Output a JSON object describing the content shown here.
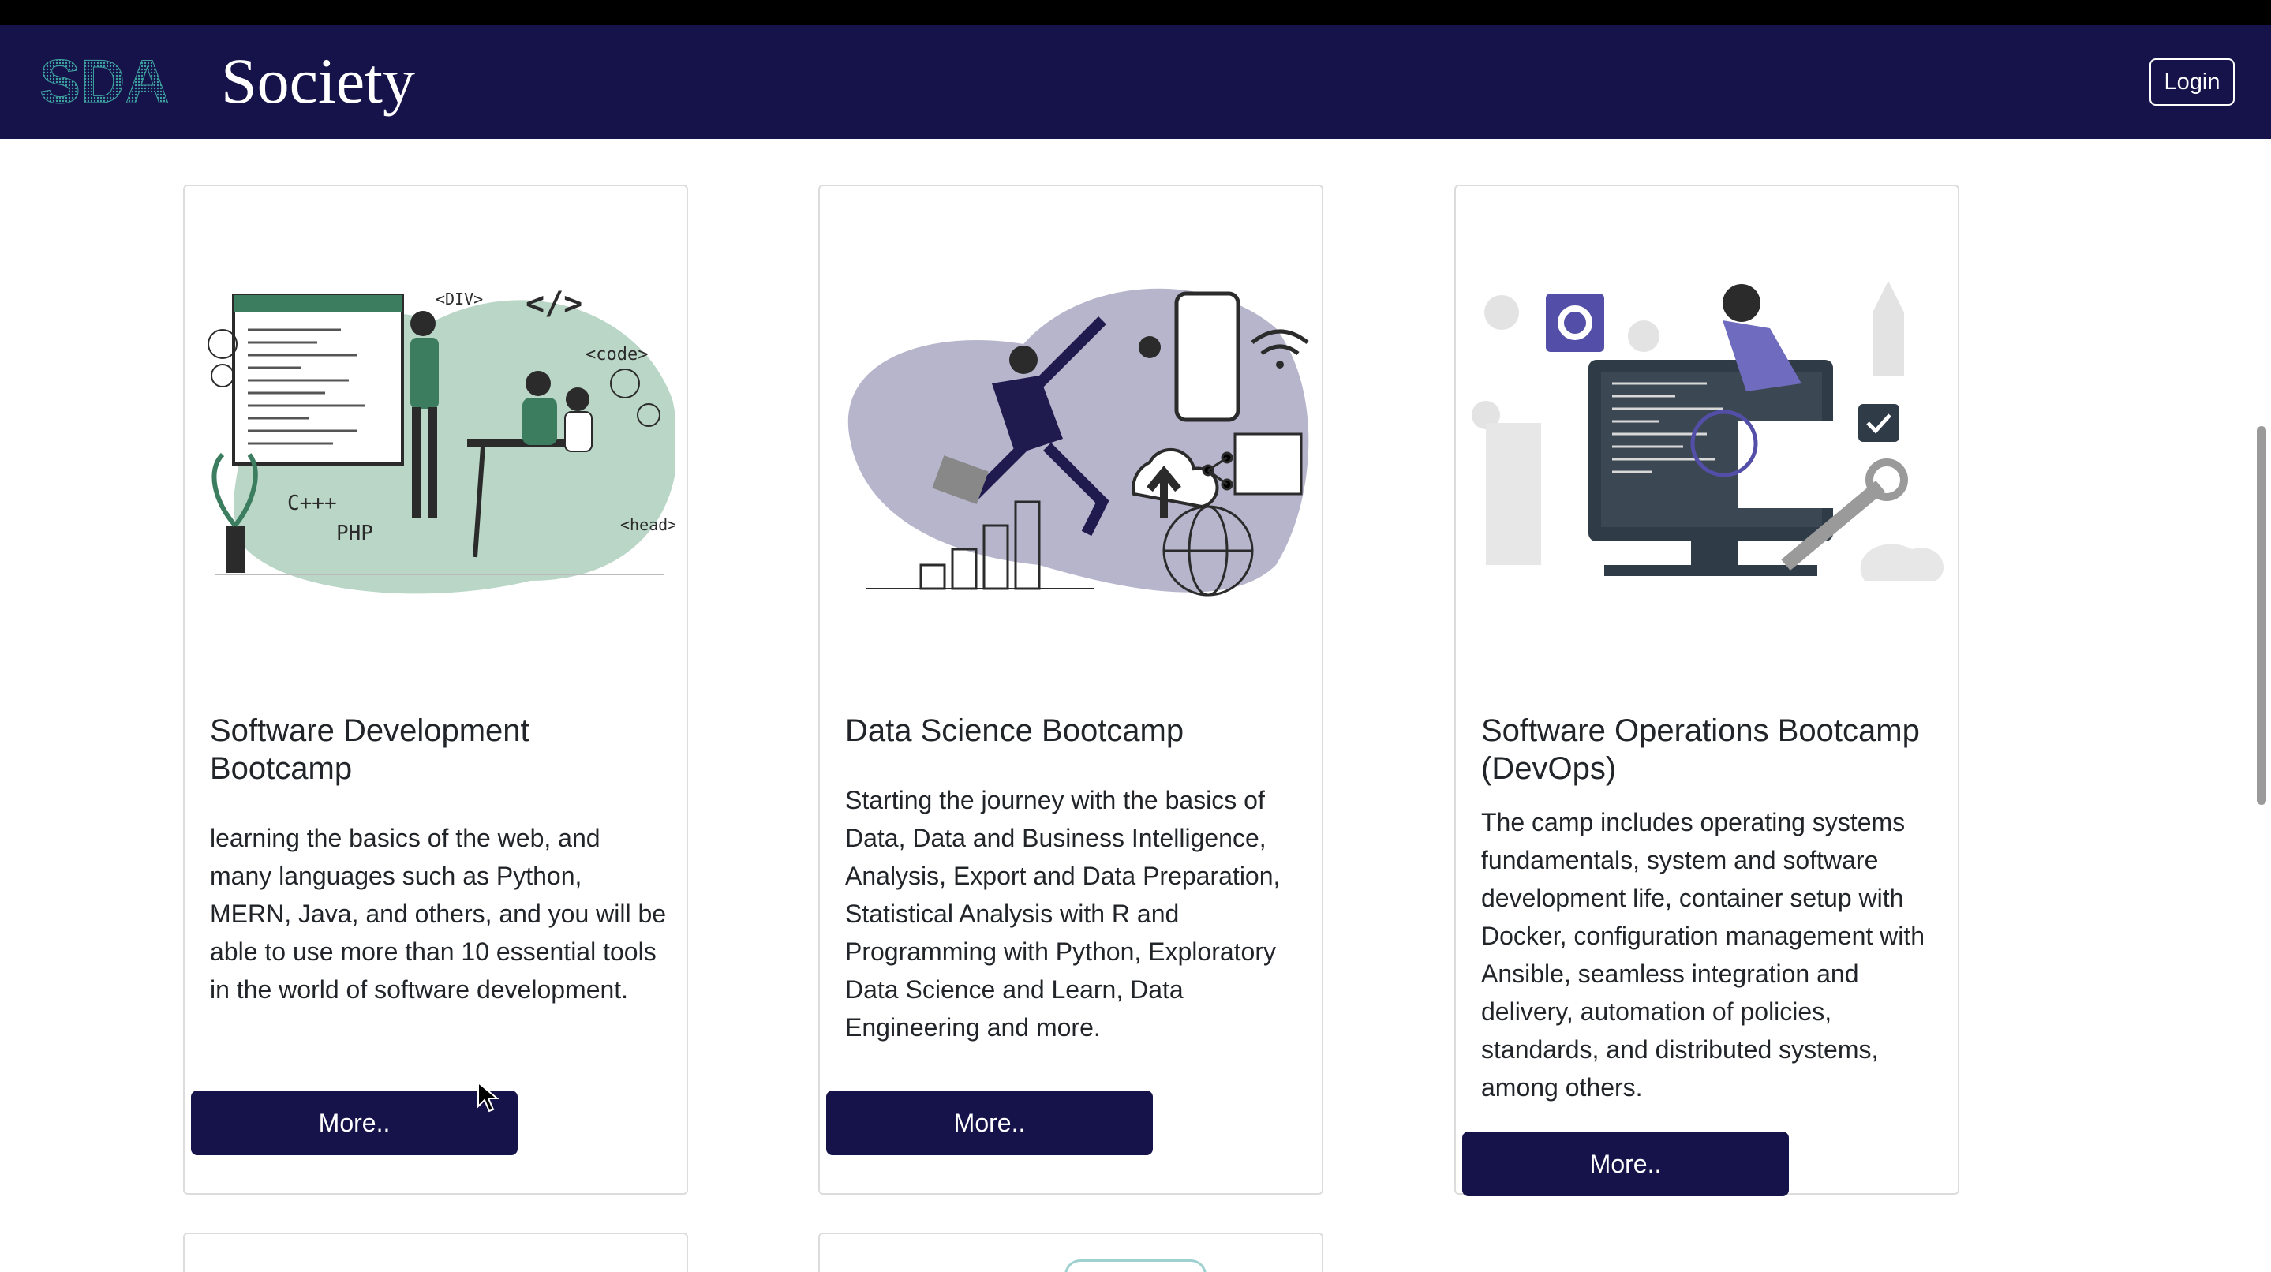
{
  "navbar": {
    "logo_text": "SDA",
    "brand": "Society",
    "login_label": "Login"
  },
  "cards": [
    {
      "title": "Software Development Bootcamp",
      "description": "learning the basics of the web, and many languages such as Python, MERN, Java, and others, and you will be able to use more than 10 essential tools in the world of software development.",
      "button_label": "More..",
      "image_labels": [
        "<DIV>",
        "</>",
        "<code>",
        "C+++",
        "PHP",
        "<head>"
      ]
    },
    {
      "title": "Data Science Bootcamp",
      "description": "Starting the journey with the basics of Data, Data and Business Intelligence, Analysis, Export and Data Preparation, Statistical Analysis with R and Programming with Python, Exploratory Data Science and Learn, Data Engineering and more.",
      "button_label": "More.."
    },
    {
      "title": "Software Operations Bootcamp (DevOps)",
      "description": "The camp includes operating systems fundamentals, system and software development life, container setup with Docker, configuration management with Ansible, seamless integration and delivery, automation of policies, standards, and distributed systems, among others.",
      "button_label": "More.."
    }
  ],
  "colors": {
    "navbar_bg": "#15134a",
    "button_bg": "#15134a",
    "card1_blob": "#b9d6c6",
    "card2_blob": "#b7b5cc",
    "accent_purple": "#534fa8"
  }
}
